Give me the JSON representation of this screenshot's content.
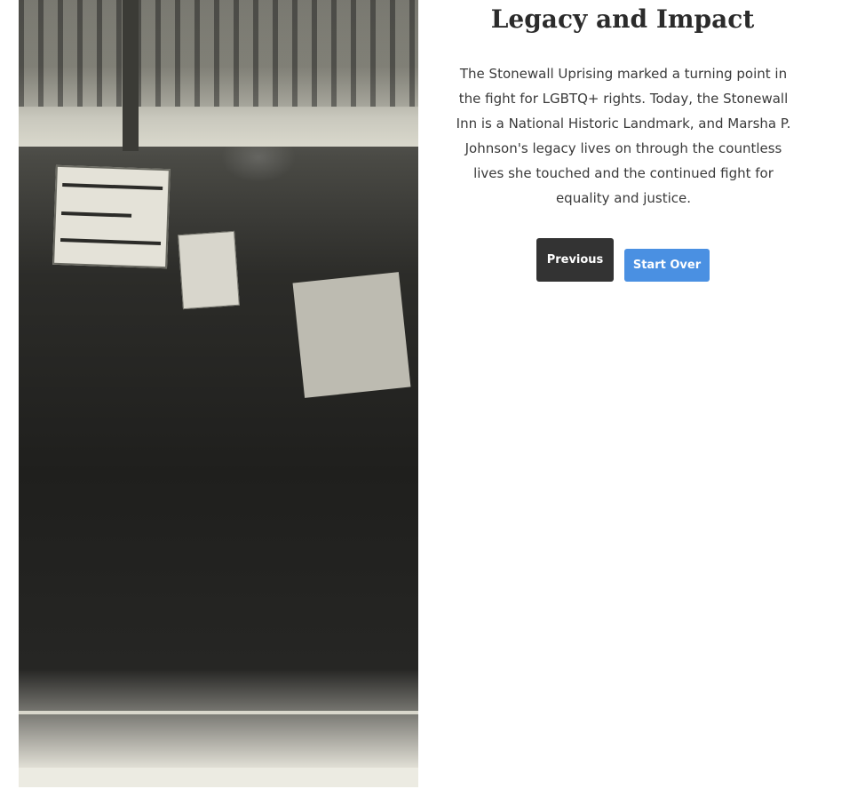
{
  "photo": {
    "alt": "Black and white photograph of a protest crowd with raised fists and handwritten signs",
    "sign_text": "HOMO IS HEALTHY"
  },
  "content": {
    "title": "Legacy and Impact",
    "paragraph": "The Stonewall Uprising marked a turning point in the fight for LGBTQ+ rights. Today, the Stonewall Inn is a National Historic Landmark, and Marsha P. Johnson's legacy lives on through the countless lives she touched and the continued fight for equality and justice."
  },
  "buttons": {
    "previous_label": "Previous",
    "start_over_label": "Start Over"
  },
  "colors": {
    "previous_bg": "#333333",
    "start_over_bg": "#4a90e2",
    "text": "#2b2b2b"
  }
}
